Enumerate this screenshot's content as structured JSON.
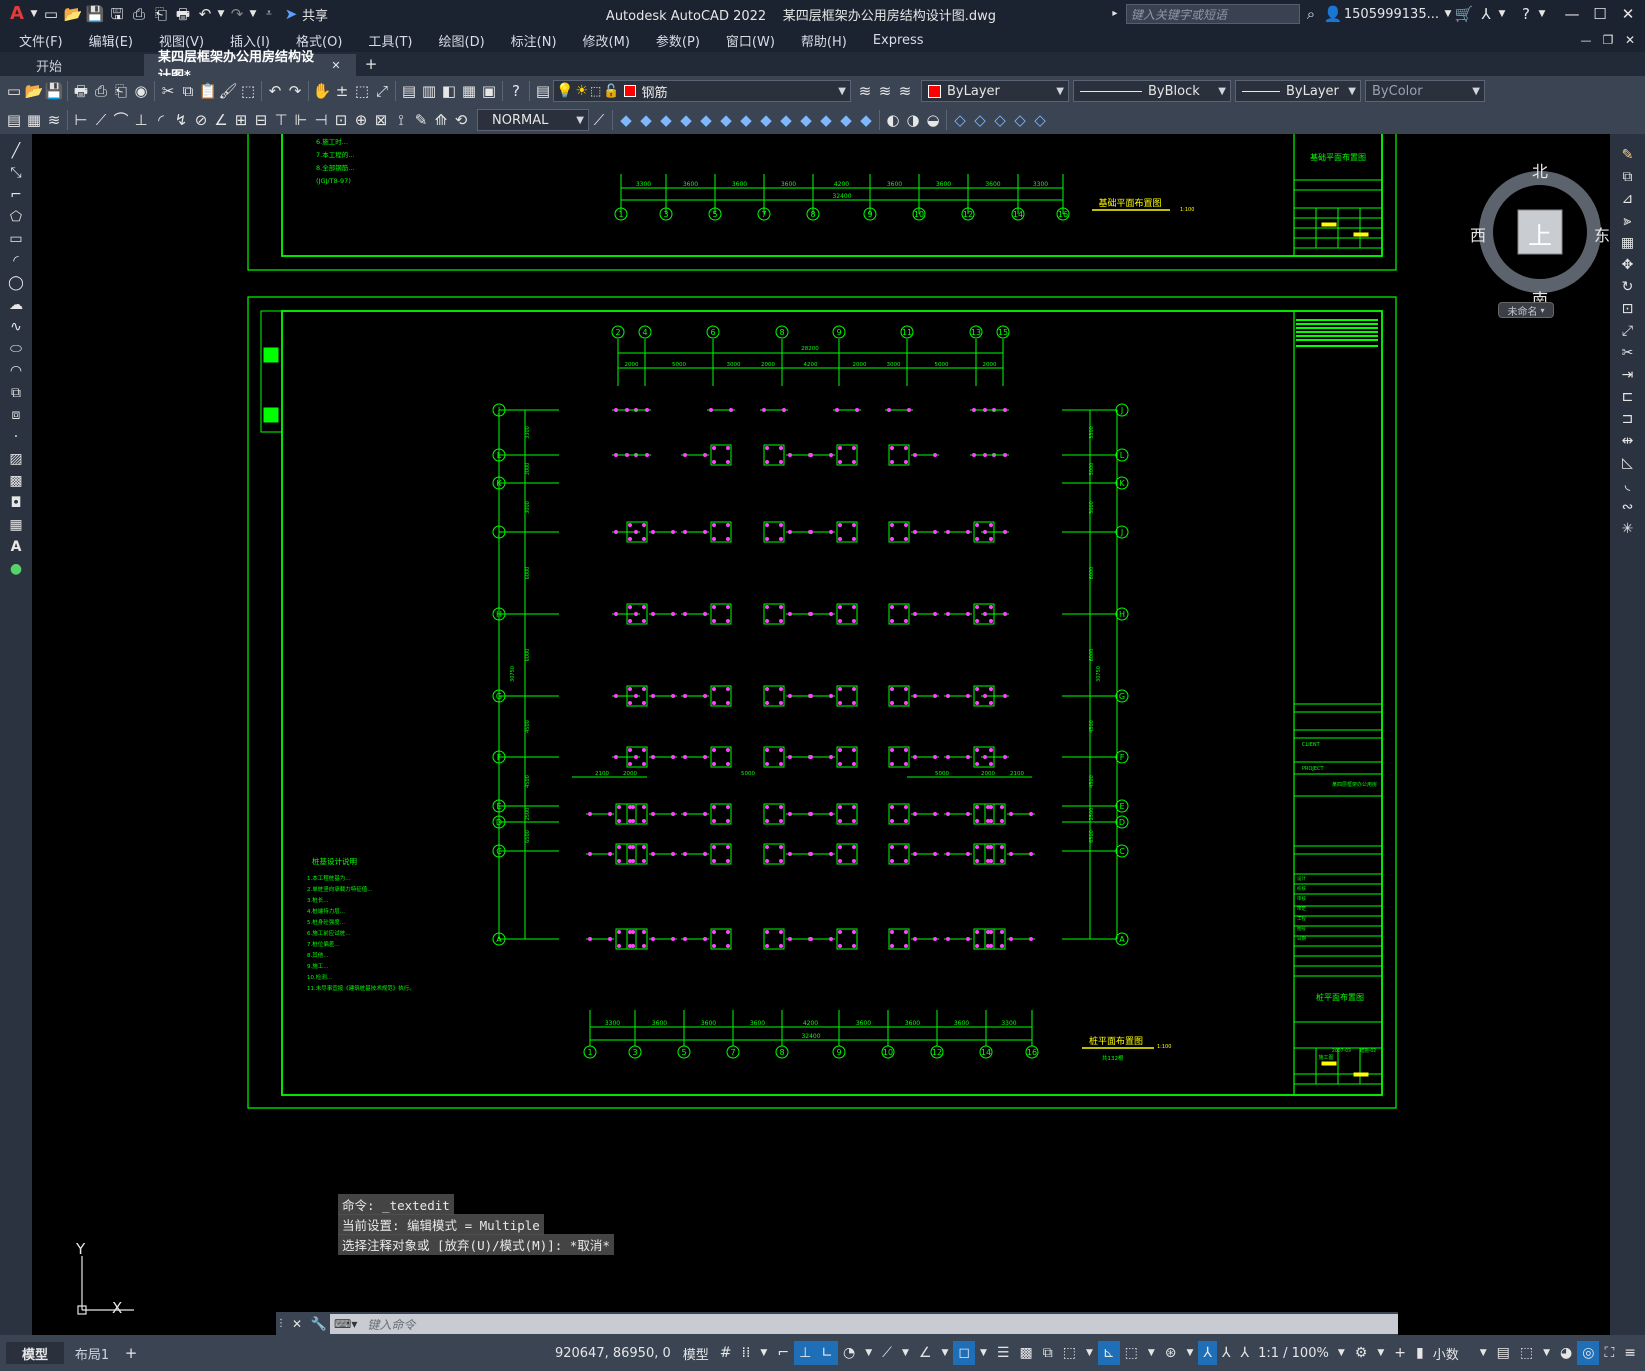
{
  "app": {
    "title": "Autodesk AutoCAD 2022    某四层框架办公用房结构设计图.dwg",
    "share_label": "共享",
    "search_placeholder": "键入关键字或短语",
    "user": "1505999135..."
  },
  "menu": [
    "文件(F)",
    "编辑(E)",
    "视图(V)",
    "插入(I)",
    "格式(O)",
    "工具(T)",
    "绘图(D)",
    "标注(N)",
    "修改(M)",
    "参数(P)",
    "窗口(W)",
    "帮助(H)",
    "Express"
  ],
  "tabs": [
    {
      "label": "开始"
    },
    {
      "label": "某四层框架办公用房结构设计图*"
    }
  ],
  "toolbar": {
    "layer": "钢筋",
    "color": "ByLayer",
    "linetype": "ByBlock",
    "lineweight": "ByLayer",
    "plotstyle": "ByColor",
    "textstyle": "NORMAL"
  },
  "compass": {
    "north": "北",
    "south": "南",
    "east": "东",
    "west": "西",
    "face": "上",
    "wcs": "未命名"
  },
  "ucs": {
    "y": "Y",
    "x": "X"
  },
  "command": {
    "history": [
      "命令: _textedit",
      "当前设置: 编辑模式 = Multiple",
      "选择注释对象或 [放弃(U)/模式(M)]: *取消*"
    ],
    "placeholder": "键入命令"
  },
  "layout_tabs": [
    "模型",
    "布局1"
  ],
  "status": {
    "coords": "920647, 86950, 0",
    "space": "模型",
    "scale": "1:1 / 100%",
    "units": "小数"
  },
  "drawing": {
    "top_title": "基础平面布置图",
    "top_scale": "1:100",
    "top_dims": [
      "3300",
      "3600",
      "3600",
      "3600",
      "4200",
      "3600",
      "3600",
      "3600",
      "3300"
    ],
    "top_total": "32400",
    "top_axes": [
      "1",
      "3",
      "5",
      "7",
      "8",
      "9",
      "10",
      "12",
      "14",
      "16"
    ],
    "top_notes": [
      "6.施工时...",
      "7.本工程的...",
      "8.全部钢筋...",
      "(JGJ/T8-97)"
    ],
    "tb_top_title": "基础平面布置图",
    "main_title": "桩平面布置图",
    "main_scale": "1:100",
    "main_sub": "共132根",
    "tb_main_title": "桩平面布置图",
    "top_axis_labels": [
      "2",
      "4",
      "6",
      "8",
      "9",
      "11",
      "13",
      "15"
    ],
    "top_axis_dims": [
      "2000",
      "5000",
      "3000",
      "2000",
      "4200",
      "2000",
      "3000",
      "5000",
      "2000"
    ],
    "top_axis_total": "28200",
    "bottom_axes": [
      "1",
      "3",
      "5",
      "7",
      "8",
      "9",
      "10",
      "12",
      "14",
      "16"
    ],
    "bottom_dims": [
      "3300",
      "3600",
      "3600",
      "3600",
      "4200",
      "3600",
      "3600",
      "3600",
      "3300"
    ],
    "bottom_total": "32400",
    "row_labels": [
      "J",
      "L",
      "K",
      "J",
      "H",
      "G",
      "F",
      "E",
      "D",
      "C",
      "A"
    ],
    "left_dims": [
      "3300",
      "3000",
      "3000",
      "6000",
      "6000",
      "4500",
      "4500",
      "2500",
      "6500"
    ],
    "left_total": "30750",
    "notes_title": "桩基设计说明",
    "notes": [
      "1.本工程桩基为...",
      "2.单桩竖向承载力特征值...",
      "3.桩长...",
      "4.桩端持力层...",
      "5.桩身砼强度...",
      "6.施工前应试桩...",
      "7.桩位偏差...",
      "8.其他...",
      "9.施工...",
      "10.检测...",
      "11.未尽事宜按《建筑桩基技术规范》执行。"
    ],
    "mid_dims": [
      "2100",
      "2000",
      "5000",
      "5000",
      "2000",
      "2100"
    ],
    "tb_fields": [
      "设计",
      "校核",
      "审核",
      "审定",
      "工程",
      "图号",
      "日期"
    ],
    "tb_project": "某四层框架办公用房",
    "tb_client": "CLIENT",
    "tb_proj_label": "PROJECT",
    "tb_drawn": "施工图",
    "tb_no": "结施-02",
    "tb_date": "2007-03"
  },
  "colors": {
    "frame": "#00ff00",
    "pile": "#ff44ff",
    "text_yellow": "#ffff00",
    "axis": "#00ff00"
  }
}
